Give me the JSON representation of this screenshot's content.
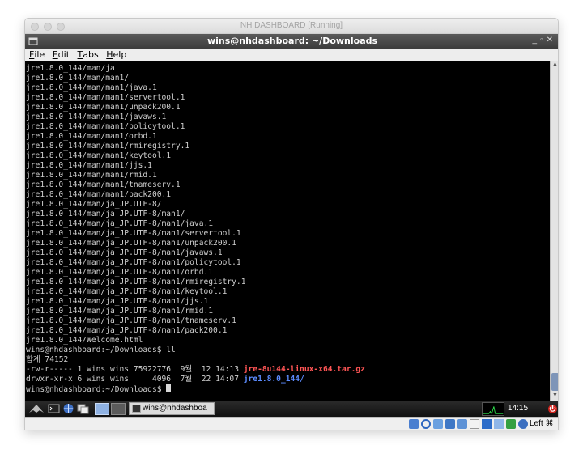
{
  "vbox": {
    "title": "NH DASHBOARD [Running]"
  },
  "terminal_window": {
    "title": "wins@nhdashboard: ~/Downloads",
    "menu": [
      "File",
      "Edit",
      "Tabs",
      "Help"
    ],
    "menu_hotkeys": [
      "F",
      "E",
      "T",
      "H"
    ]
  },
  "terminal": {
    "lines": [
      "jre1.8.0_144/man/ja",
      "jre1.8.0_144/man/man1/",
      "jre1.8.0_144/man/man1/java.1",
      "jre1.8.0_144/man/man1/servertool.1",
      "jre1.8.0_144/man/man1/unpack200.1",
      "jre1.8.0_144/man/man1/javaws.1",
      "jre1.8.0_144/man/man1/policytool.1",
      "jre1.8.0_144/man/man1/orbd.1",
      "jre1.8.0_144/man/man1/rmiregistry.1",
      "jre1.8.0_144/man/man1/keytool.1",
      "jre1.8.0_144/man/man1/jjs.1",
      "jre1.8.0_144/man/man1/rmid.1",
      "jre1.8.0_144/man/man1/tnameserv.1",
      "jre1.8.0_144/man/man1/pack200.1",
      "jre1.8.0_144/man/ja_JP.UTF-8/",
      "jre1.8.0_144/man/ja_JP.UTF-8/man1/",
      "jre1.8.0_144/man/ja_JP.UTF-8/man1/java.1",
      "jre1.8.0_144/man/ja_JP.UTF-8/man1/servertool.1",
      "jre1.8.0_144/man/ja_JP.UTF-8/man1/unpack200.1",
      "jre1.8.0_144/man/ja_JP.UTF-8/man1/javaws.1",
      "jre1.8.0_144/man/ja_JP.UTF-8/man1/policytool.1",
      "jre1.8.0_144/man/ja_JP.UTF-8/man1/orbd.1",
      "jre1.8.0_144/man/ja_JP.UTF-8/man1/rmiregistry.1",
      "jre1.8.0_144/man/ja_JP.UTF-8/man1/keytool.1",
      "jre1.8.0_144/man/ja_JP.UTF-8/man1/jjs.1",
      "jre1.8.0_144/man/ja_JP.UTF-8/man1/rmid.1",
      "jre1.8.0_144/man/ja_JP.UTF-8/man1/tnameserv.1",
      "jre1.8.0_144/man/ja_JP.UTF-8/man1/pack200.1",
      "jre1.8.0_144/Welcome.html",
      "wins@nhdashboard:~/Downloads$ ll",
      "합계 74152"
    ],
    "listing": [
      {
        "prefix": "-rw-r----- 1 wins wins 75922776  9월  12 14:13 ",
        "name": "jre-8u144-linux-x64.tar.gz",
        "color": "#ff5555"
      },
      {
        "prefix": "drwxr-xr-x 6 wins wins     4096  7월  22 14:07 ",
        "name": "jre1.8.0_144/",
        "color": "#5c8cff"
      }
    ],
    "prompt": "wins@nhdashboard:~/Downloads$ "
  },
  "panel": {
    "task_label": "wins@nhdashboa",
    "clock": "14:15",
    "host_key": "Left ⌘"
  }
}
